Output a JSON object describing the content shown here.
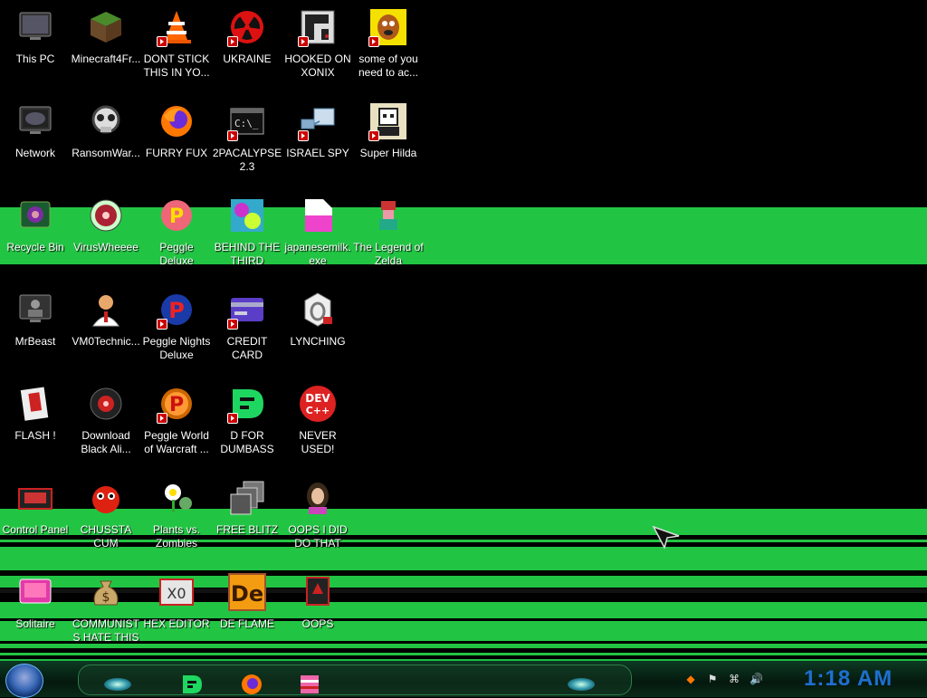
{
  "desktop": {
    "icons": [
      {
        "label": "This PC",
        "icon": "computer-icon"
      },
      {
        "label": "Minecraft4Fr...",
        "icon": "minecraft-block-icon"
      },
      {
        "label": "DONT STICK THIS IN YO...",
        "icon": "traffic-cone-icon"
      },
      {
        "label": "UKRAINE",
        "icon": "radiation-icon"
      },
      {
        "label": "HOOKED ON XONIX",
        "icon": "xonix-game-icon"
      },
      {
        "label": "some of you need to ac...",
        "icon": "cartoon-dog-icon"
      },
      {
        "label": "Network",
        "icon": "network-globe-icon"
      },
      {
        "label": "RansomWar...",
        "icon": "skull-icon"
      },
      {
        "label": "FURRY FUX",
        "icon": "firefox-icon"
      },
      {
        "label": "2PACALYPSE 2.3",
        "icon": "command-prompt-icon"
      },
      {
        "label": "ISRAEL SPY",
        "icon": "spy-network-icon"
      },
      {
        "label": "Super Hilda",
        "icon": "pixel-art-icon"
      },
      {
        "label": "Recycle Bin",
        "icon": "recycle-bin-icon"
      },
      {
        "label": "VirusWheeee",
        "icon": "virus-wheel-icon"
      },
      {
        "label": "Peggle Deluxe",
        "icon": "peggle-icon"
      },
      {
        "label": "BEHIND THE THIRD DUNGEON",
        "icon": "colorful-art-icon"
      },
      {
        "label": "japanesemilk.exe",
        "icon": "document-icon"
      },
      {
        "label": "The Legend of Zelda",
        "icon": "pixel-character-icon"
      },
      {
        "label": "MrBeast",
        "icon": "person-icon"
      },
      {
        "label": "VM0Technic...",
        "icon": "doctor-icon"
      },
      {
        "label": "Peggle Nights Deluxe",
        "icon": "peggle-nights-icon"
      },
      {
        "label": "CREDIT CARD CHECKER",
        "icon": "credit-card-icon"
      },
      {
        "label": "LYNCHING",
        "icon": "noose-icon"
      },
      {
        "label": "FLASH !",
        "icon": "flash-card-icon"
      },
      {
        "label": "Download Black Ali...",
        "icon": "robot-eye-icon"
      },
      {
        "label": "Peggle World of Warcraft ...",
        "icon": "peggle-wow-icon"
      },
      {
        "label": "D FOR DUMBASS",
        "icon": "d-logo-icon"
      },
      {
        "label": "NEVER USED!",
        "icon": "dev-cpp-icon"
      },
      {
        "label": "Control Panel",
        "icon": "control-panel-icon"
      },
      {
        "label": "CHUSSTA CUM",
        "icon": "red-creature-icon"
      },
      {
        "label": "Plants vs. Zombies",
        "icon": "flower-icon"
      },
      {
        "label": "FREE BLITZ",
        "icon": "stacked-windows-icon"
      },
      {
        "label": "OOPS I DID DO THAT",
        "icon": "portrait-icon"
      },
      {
        "label": "Solitaire",
        "icon": "pink-device-icon"
      },
      {
        "label": "COMMUNISTS HATE THIS e...",
        "icon": "money-bag-icon"
      },
      {
        "label": "HEX EDITOR",
        "icon": "hex-editor-icon"
      },
      {
        "label": "DE FLAME",
        "icon": "de-logo-icon"
      },
      {
        "label": "OOPS",
        "icon": "red-card-icon"
      }
    ]
  },
  "taskbar": {
    "start_icon": "start-orb-icon",
    "pinned": [
      {
        "icon": "oval-glow-icon"
      },
      {
        "icon": "d-app-icon"
      },
      {
        "icon": "firefox-icon"
      },
      {
        "icon": "pixel-app-icon"
      }
    ],
    "tray": [
      {
        "icon": "tray-app-icon",
        "glyph": "◆"
      },
      {
        "icon": "flag-icon",
        "glyph": "⚑"
      },
      {
        "icon": "network-icon",
        "glyph": "⌘"
      },
      {
        "icon": "volume-icon",
        "glyph": "🔊"
      }
    ],
    "clock": "1:18 AM"
  },
  "colors": {
    "background": "#000000",
    "glitch_green": "#22c543",
    "clock_blue": "#1e6fd0"
  }
}
